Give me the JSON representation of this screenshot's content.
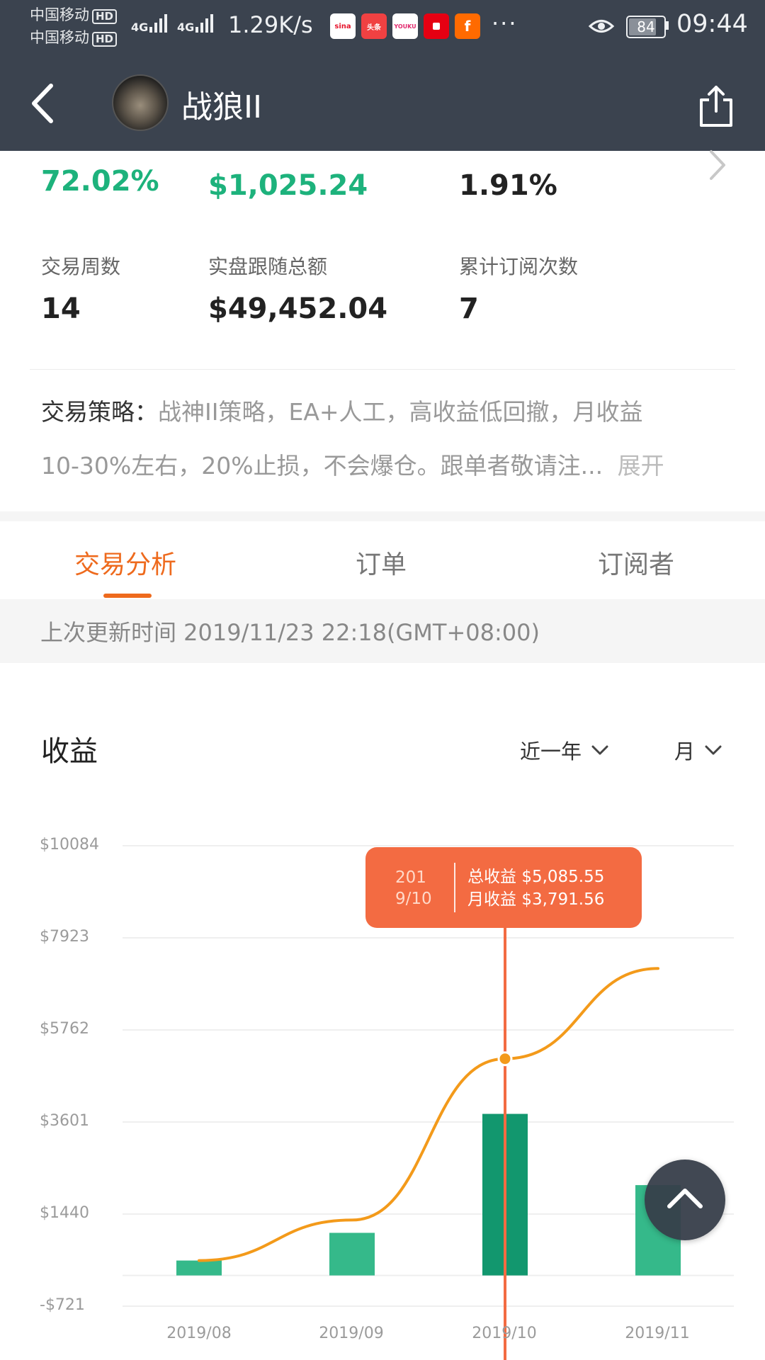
{
  "status_bar": {
    "carrier1": "中国移动",
    "carrier2": "中国移动",
    "hd": "HD",
    "net1": "4G",
    "net2": "4G",
    "speed": "1.29K/s",
    "app_icons": [
      {
        "name": "sina-icon",
        "text": "sina",
        "color": "#e6162d"
      },
      {
        "name": "toutiao-icon",
        "text": "头条",
        "color": "#f04142"
      },
      {
        "name": "youku-icon",
        "text": "YOUKU",
        "color": "#ffffff"
      },
      {
        "name": "red-app-icon",
        "text": "",
        "color": "#e60012"
      },
      {
        "name": "orange-app-icon",
        "text": "",
        "color": "#ff6a00"
      }
    ],
    "more": "···",
    "battery": "84",
    "time": "09:44"
  },
  "header": {
    "title": "战狼II",
    "back_icon": "back-arrow-icon",
    "share_icon": "share-icon"
  },
  "metrics_top": {
    "v1": "72.02%",
    "v2": "$1,025.24",
    "v3": "1.91%"
  },
  "metrics": [
    {
      "label": "交易周数",
      "value": "14"
    },
    {
      "label": "实盘跟随总额",
      "value": "$49,452.04"
    },
    {
      "label": "累计订阅次数",
      "value": "7"
    }
  ],
  "strategy": {
    "label": "交易策略：",
    "line1": "战神II策略，EA+人工，高收益低回撤，月收益",
    "line2": "10-30%左右，20%止损，不会爆仓。跟单者敬请注...",
    "expand": "展开"
  },
  "tabs": [
    "交易分析",
    "订单",
    "订阅者"
  ],
  "update_time": "上次更新时间 2019/11/23 22:18(GMT+08:00)",
  "chart_section": {
    "title": "收益",
    "range_select": "近一年",
    "period_select": "月"
  },
  "colors": {
    "accent": "#ee6a1d",
    "green": "#1db27c",
    "bar": "#35b98a",
    "bar_selected": "#12976e",
    "line": "#f39a1a",
    "tooltip": "#f36b42"
  },
  "chart_data": {
    "type": "bar",
    "title": "收益",
    "categories": [
      "2019/08",
      "2019/09",
      "2019/10",
      "2019/11"
    ],
    "y_tick_labels": [
      "$10084",
      "$7923",
      "$5762",
      "$3601",
      "$1440",
      "-$721"
    ],
    "ylim": [
      -721,
      10084
    ],
    "series": [
      {
        "name": "月收益",
        "type": "bar",
        "values": [
          350,
          1000,
          3791.56,
          2120
        ]
      },
      {
        "name": "总收益",
        "type": "line",
        "values": [
          350,
          1300,
          5085.55,
          7205
        ]
      }
    ],
    "selected_index": 2,
    "tooltip": {
      "period": "2019/10",
      "total_label": "总收益",
      "total_value": "$5,085.55",
      "month_label": "月收益",
      "month_value": "$3,791.56"
    }
  }
}
